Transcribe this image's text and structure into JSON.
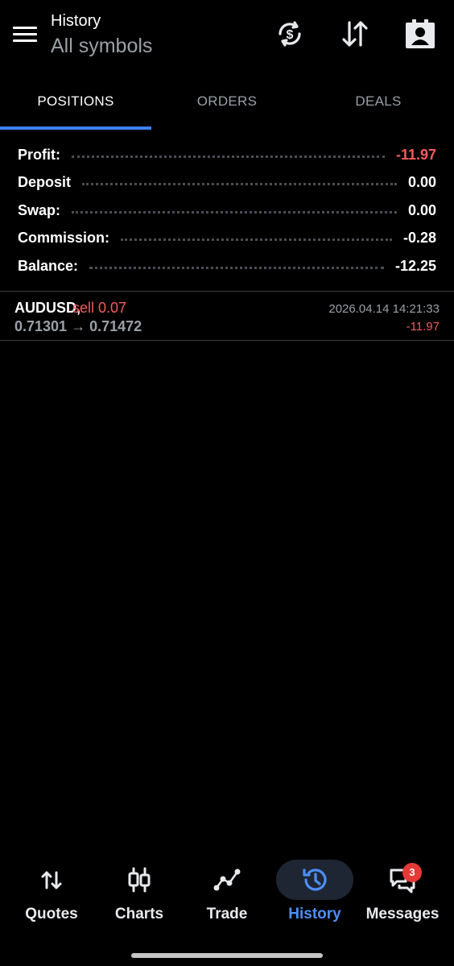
{
  "header": {
    "title": "History",
    "subtitle": "All symbols"
  },
  "tabs": [
    {
      "label": "POSITIONS",
      "active": true
    },
    {
      "label": "ORDERS",
      "active": false
    },
    {
      "label": "DEALS",
      "active": false
    }
  ],
  "summary": [
    {
      "label": "Profit:",
      "value": "-11.97"
    },
    {
      "label": "Deposit",
      "value": "0.00"
    },
    {
      "label": "Swap:",
      "value": "0.00"
    },
    {
      "label": "Commission:",
      "value": "-0.28"
    },
    {
      "label": "Balance:",
      "value": "-12.25"
    }
  ],
  "position": {
    "symbol": "AUDUSD,",
    "side": "sell 0.07",
    "prices": "0.71301 → 0.71472",
    "time": "2026.04.14 14:21:33",
    "profit": "-11.97"
  },
  "nav": [
    {
      "label": "Quotes",
      "icon": "quotes-icon"
    },
    {
      "label": "Charts",
      "icon": "charts-icon"
    },
    {
      "label": "Trade",
      "icon": "trade-icon"
    },
    {
      "label": "History",
      "icon": "history-icon",
      "active": true
    },
    {
      "label": "Messages",
      "icon": "messages-icon"
    }
  ],
  "messages_badge": "3",
  "colors": {
    "accent": "#3b82f6",
    "negative": "#f45b5b",
    "active_nav": "#4d8ff7"
  }
}
